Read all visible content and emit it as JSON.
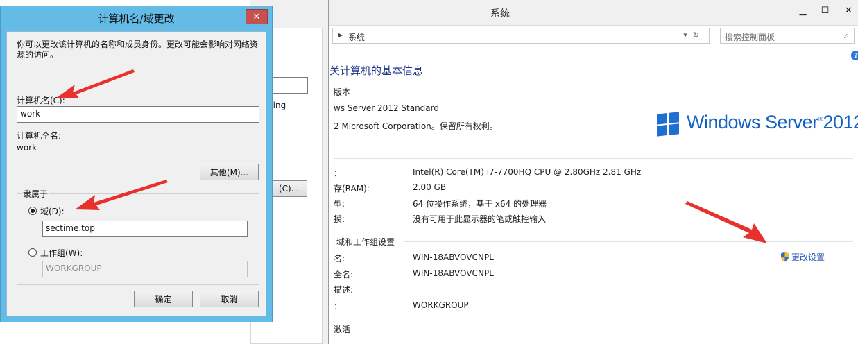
{
  "system_window": {
    "title": "系统",
    "breadcrumb": "系统",
    "search_placeholder": "搜索控制面板",
    "help_glyph": "?",
    "page_title": "关计算机的基本信息",
    "edition_header": "版本",
    "edition": "ws Server 2012 Standard",
    "copyright": "2 Microsoft Corporation。保留所有权利。",
    "logo_text": "Windows Server",
    "logo_version": "2012",
    "system_rows": [
      {
        "label": "：",
        "value": "Intel(R) Core(TM) i7-7700HQ CPU @ 2.80GHz   2.81 GHz"
      },
      {
        "label": "存(RAM):",
        "value": "2.00 GB"
      },
      {
        "label": "型:",
        "value": "64 位操作系统，基于 x64 的处理器"
      },
      {
        "label": "摸:",
        "value": "没有可用于此显示器的笔或触控输入"
      }
    ],
    "domain_header": "域和工作组设置",
    "domain_rows": [
      {
        "label": "名:",
        "value": "WIN-18ABVOVCNPL"
      },
      {
        "label": "全名:",
        "value": "WIN-18ABVOVCNPL"
      },
      {
        "label": "描述:",
        "value": ""
      },
      {
        "label": "：",
        "value": "WORKGROUP"
      }
    ],
    "change_settings": "更改设置",
    "activation_header": "激活"
  },
  "middle_window": {
    "text_partial": "inting",
    "button_partial": "(C)..."
  },
  "dialog": {
    "title": "计算机名/域更改",
    "close": "✕",
    "description": "你可以更改该计算机的名称和成员身份。更改可能会影响对网络资源的访问。",
    "computer_name_label": "计算机名(C):",
    "computer_name_value": "work",
    "full_name_label": "计算机全名:",
    "full_name_value": "work",
    "more_button": "其他(M)...",
    "member_of_label": "隶属于",
    "domain_label": "域(D):",
    "domain_value": "sectime.top",
    "workgroup_label": "工作组(W):",
    "workgroup_value": "WORKGROUP",
    "ok_button": "确定",
    "cancel_button": "取消"
  },
  "colors": {
    "dialog_frame": "#63bbe6",
    "close_button": "#c75050",
    "link": "#1e50b4",
    "title_blue": "#1e3287",
    "logo_blue": "#1461c6",
    "arrow_red": "#e8312c"
  }
}
